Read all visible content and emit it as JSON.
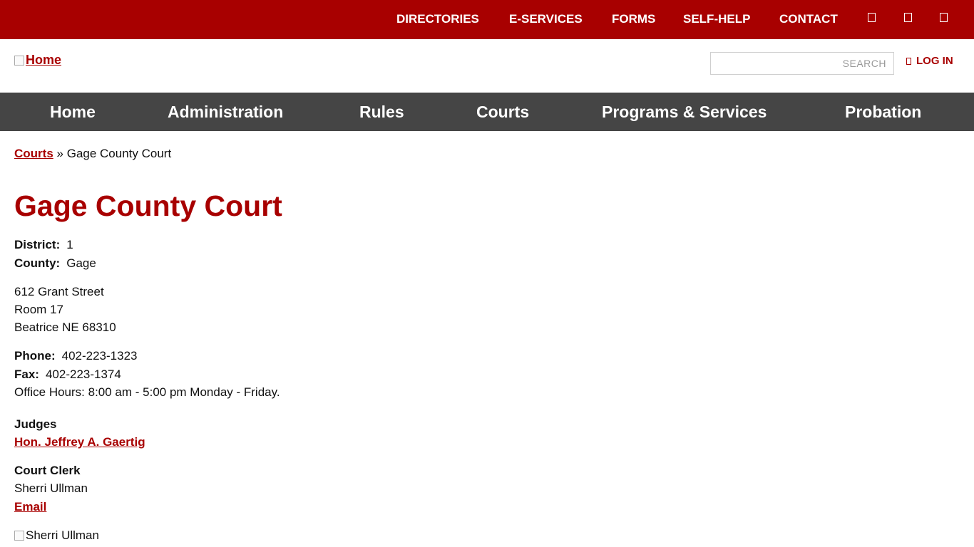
{
  "utility_nav": {
    "items": [
      "DIRECTORIES",
      "E-SERVICES",
      "FORMS",
      "SELF-HELP",
      "CONTACT"
    ],
    "icons": [
      "social-icon-1",
      "social-icon-2",
      "social-icon-3"
    ]
  },
  "header": {
    "logo_alt": "Home",
    "search_placeholder": "SEARCH",
    "login_label": "LOG IN"
  },
  "main_nav": [
    "Home",
    "Administration",
    "Rules",
    "Courts",
    "Programs & Services",
    "Probation"
  ],
  "breadcrumb": {
    "parent": "Courts",
    "separator": "»",
    "current": "Gage County Court"
  },
  "page_title": "Gage County Court",
  "details": {
    "district_label": "District:",
    "district": "1",
    "county_label": "County:",
    "county": "Gage"
  },
  "address": {
    "street": "612 Grant Street",
    "room": "Room 17",
    "city": "Beatrice NE 68310"
  },
  "contact": {
    "phone_label": "Phone:",
    "phone": "402-223-1323",
    "fax_label": "Fax:",
    "fax": "402-223-1374",
    "hours": "Office Hours: 8:00 am - 5:00 pm Monday - Friday."
  },
  "judges": {
    "heading": "Judges",
    "names": [
      "Hon. Jeffrey A. Gaertig"
    ]
  },
  "clerk": {
    "heading": "Court Clerk",
    "name": "Sherri Ullman",
    "email_label": "Email",
    "image_alt": "Sherri Ullman"
  },
  "colors": {
    "brand": "#a80000",
    "nav_bg": "#454545"
  }
}
